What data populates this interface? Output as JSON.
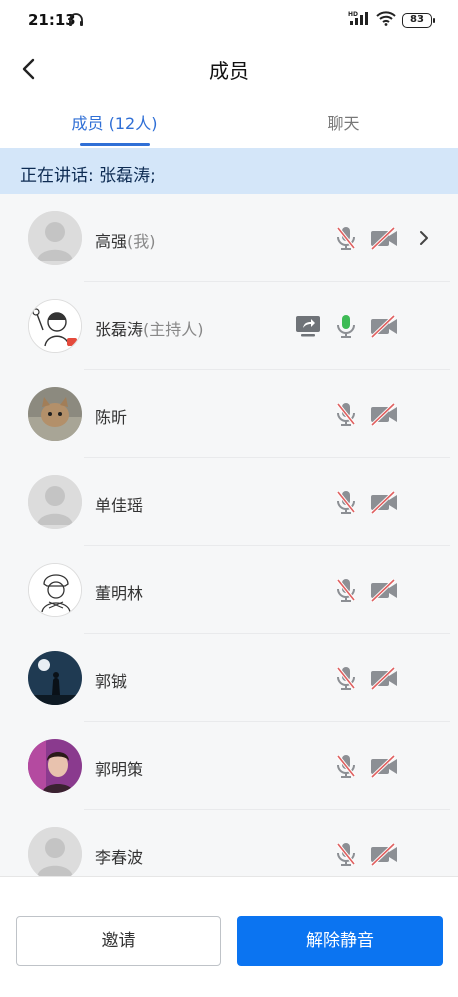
{
  "status": {
    "time": "21:13",
    "battery": "83",
    "network": "HD"
  },
  "header": {
    "title": "成员"
  },
  "tabs": [
    {
      "label": "成员 (12人)"
    },
    {
      "label": "聊天"
    }
  ],
  "banner": {
    "text": "正在讲话: 张磊涛;"
  },
  "members": [
    {
      "name": "高强",
      "suffix": "(我)",
      "avatar": "default-avatar",
      "mic": "muted",
      "camera": "off"
    },
    {
      "name": "张磊涛",
      "suffix": "(主持人)",
      "avatar": "cartoon-avatar",
      "mic": "on",
      "camera": "off",
      "sharing": true
    },
    {
      "name": "陈昕",
      "suffix": "",
      "avatar": "cat-photo-avatar",
      "mic": "muted",
      "camera": "off"
    },
    {
      "name": "单佳瑶",
      "suffix": "",
      "avatar": "default-avatar",
      "mic": "muted",
      "camera": "off"
    },
    {
      "name": "董明林",
      "suffix": "",
      "avatar": "sketch-avatar",
      "mic": "muted",
      "camera": "off"
    },
    {
      "name": "郭铖",
      "suffix": "",
      "avatar": "night-photo-avatar",
      "mic": "muted",
      "camera": "off"
    },
    {
      "name": "郭明策",
      "suffix": "",
      "avatar": "portrait-photo-avatar",
      "mic": "muted",
      "camera": "off"
    },
    {
      "name": "李春波",
      "suffix": "",
      "avatar": "default-avatar",
      "mic": "muted",
      "camera": "off"
    }
  ],
  "actions": {
    "invite": "邀请",
    "unmute": "解除静音"
  },
  "colors": {
    "accent": "#0b74f1",
    "tab_active": "#2f6fd6",
    "banner_bg": "#d4e6f9",
    "mic_on": "#3dbb55",
    "muted_slash": "#e06060"
  }
}
